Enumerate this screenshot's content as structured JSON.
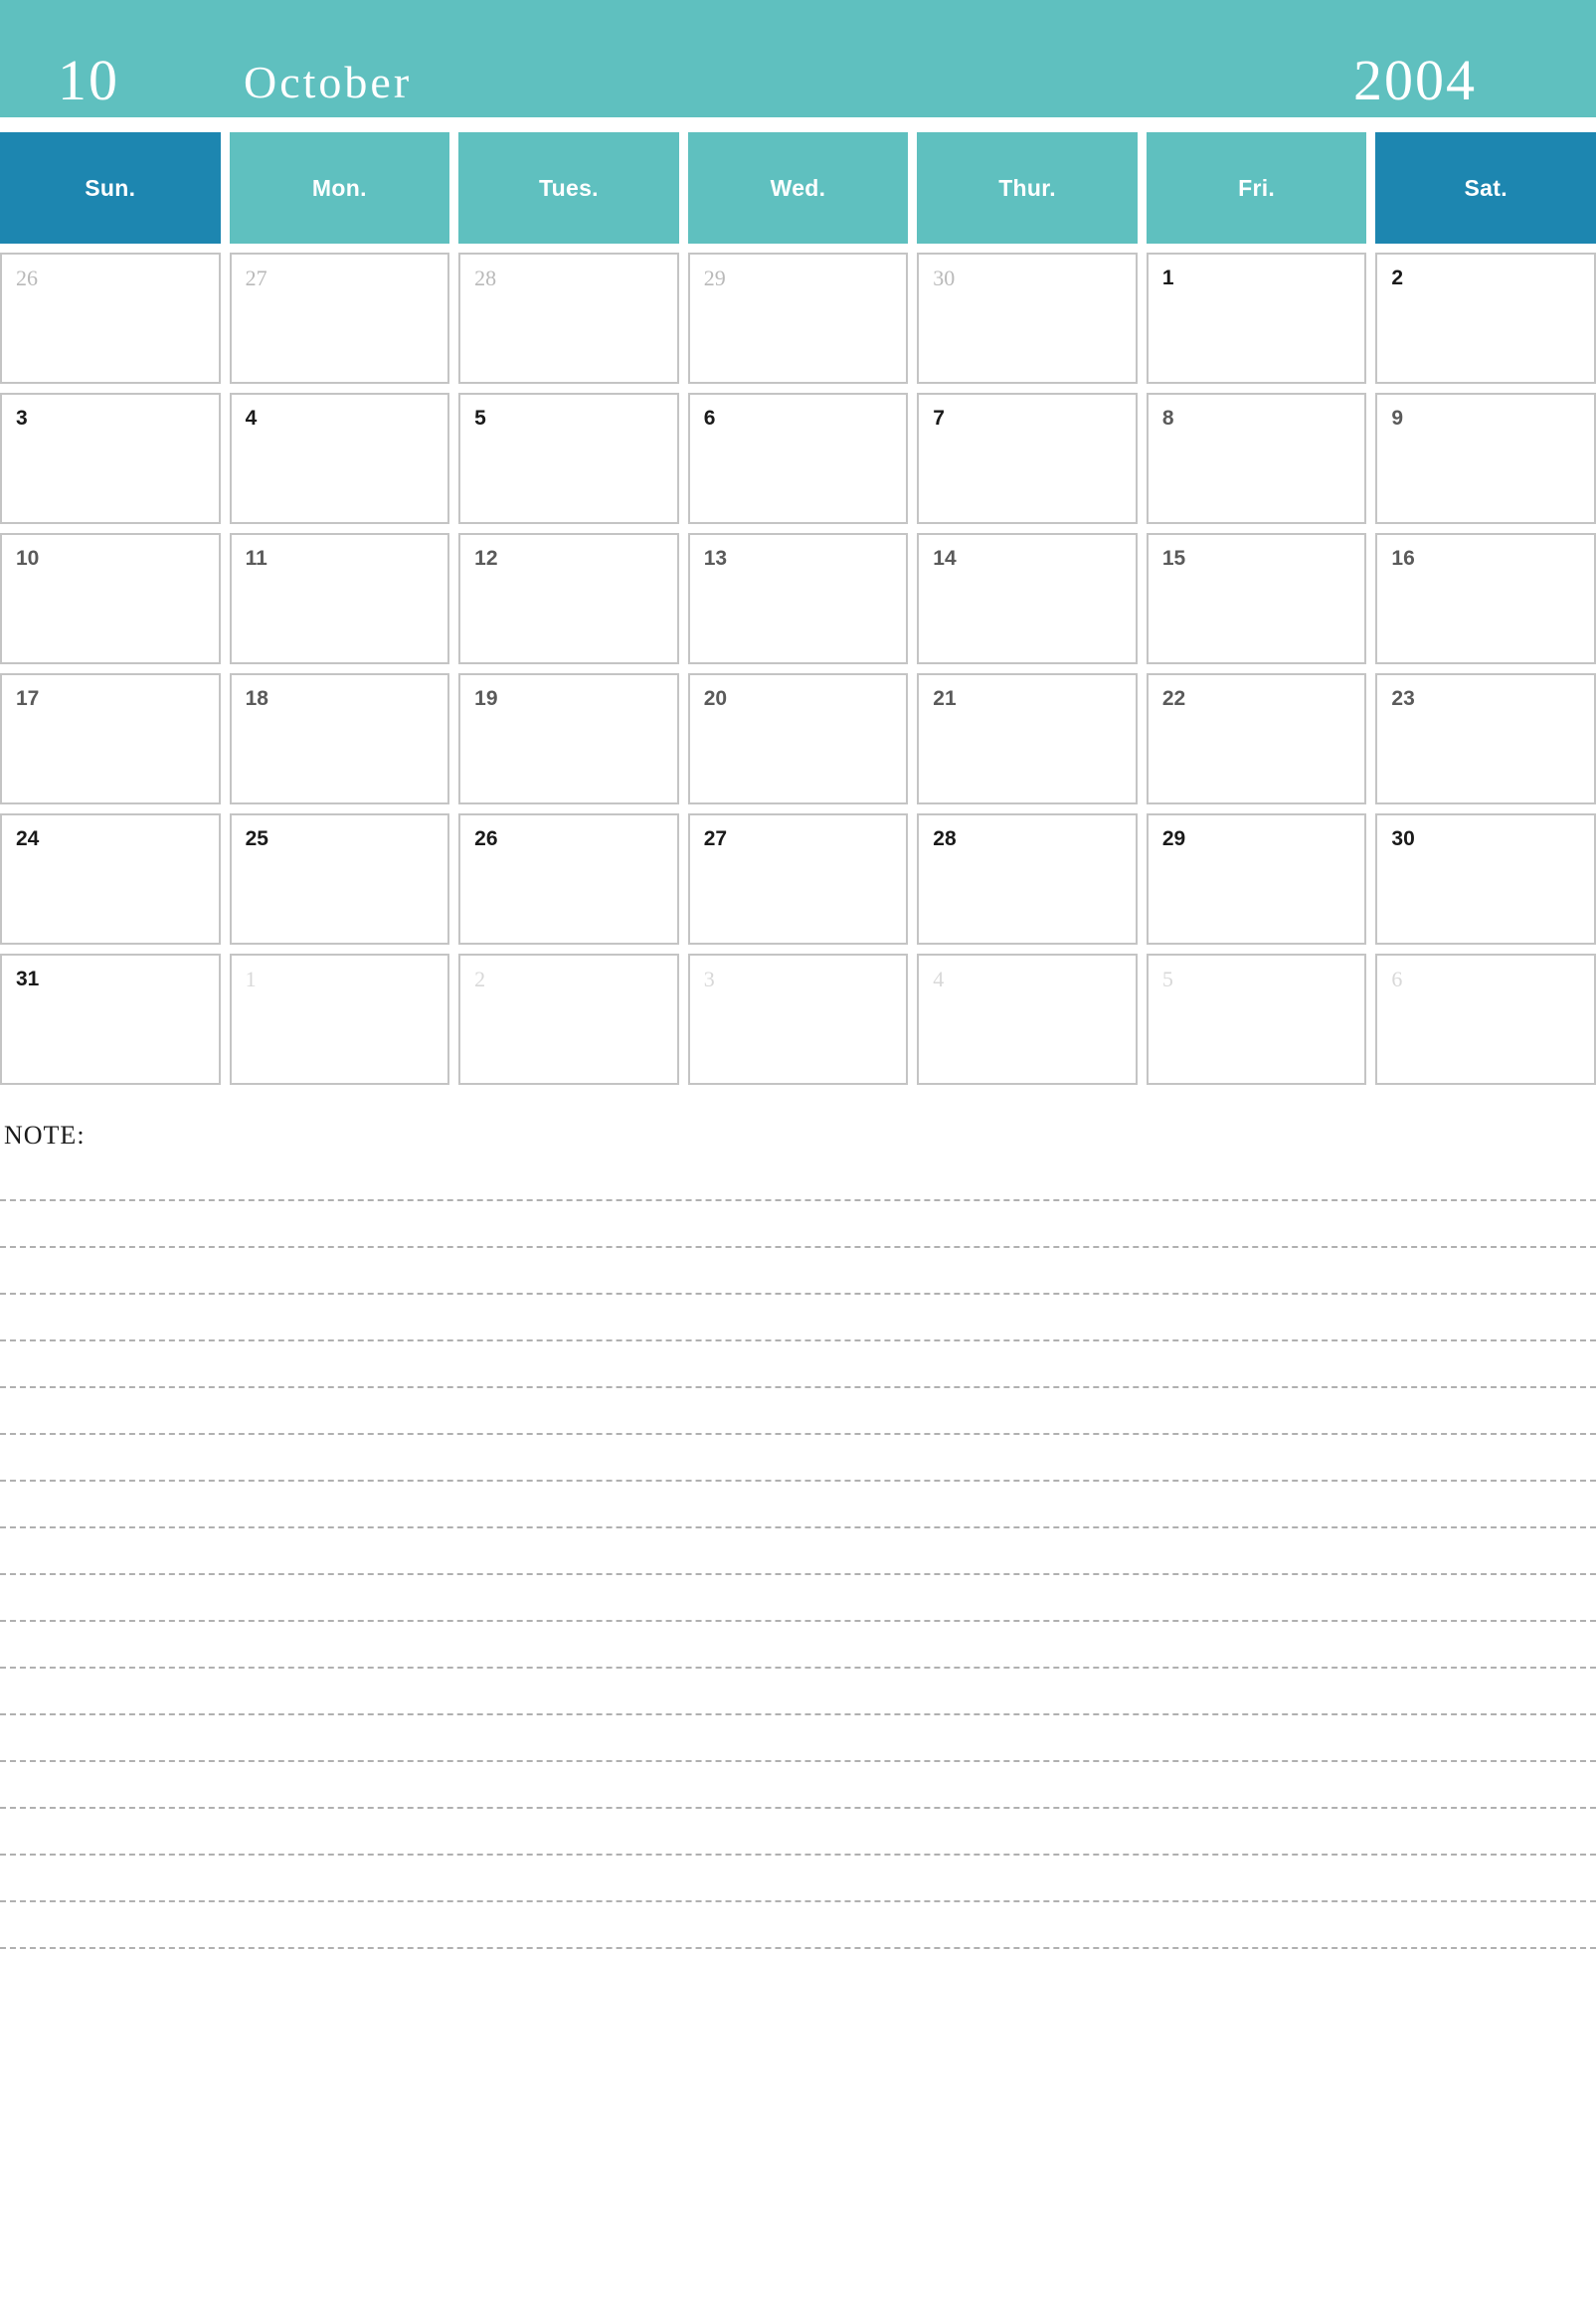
{
  "header": {
    "month_number": "10",
    "month_name": "October",
    "year": "2004",
    "background_color": "#5fc0bf",
    "text_color": "#ffffff"
  },
  "weekdays": [
    {
      "label": "Sun.",
      "weekend": true
    },
    {
      "label": "Mon.",
      "weekend": false
    },
    {
      "label": "Tues.",
      "weekend": false
    },
    {
      "label": "Wed.",
      "weekend": false
    },
    {
      "label": "Thur.",
      "weekend": false
    },
    {
      "label": "Fri.",
      "weekend": false
    },
    {
      "label": "Sat.",
      "weekend": true
    }
  ],
  "colors": {
    "teal": "#5fc0bf",
    "blue": "#1d86b0",
    "cell_border": "#c4c4c4",
    "note_line": "#b0b0b0"
  },
  "weeks": [
    [
      {
        "day": "26",
        "style": "adjacent"
      },
      {
        "day": "27",
        "style": "adjacent"
      },
      {
        "day": "28",
        "style": "adjacent"
      },
      {
        "day": "29",
        "style": "adjacent"
      },
      {
        "day": "30",
        "style": "adjacent"
      },
      {
        "day": "1",
        "style": "current-strong"
      },
      {
        "day": "2",
        "style": "current-strong"
      }
    ],
    [
      {
        "day": "3",
        "style": "current-strong"
      },
      {
        "day": "4",
        "style": "current-strong"
      },
      {
        "day": "5",
        "style": "current-strong"
      },
      {
        "day": "6",
        "style": "current-strong"
      },
      {
        "day": "7",
        "style": "current-strong"
      },
      {
        "day": "8",
        "style": "current-mid"
      },
      {
        "day": "9",
        "style": "current-mid"
      }
    ],
    [
      {
        "day": "10",
        "style": "current-mid"
      },
      {
        "day": "11",
        "style": "current-mid"
      },
      {
        "day": "12",
        "style": "current-mid"
      },
      {
        "day": "13",
        "style": "current-mid"
      },
      {
        "day": "14",
        "style": "current-mid"
      },
      {
        "day": "15",
        "style": "current-mid"
      },
      {
        "day": "16",
        "style": "current-mid"
      }
    ],
    [
      {
        "day": "17",
        "style": "current-mid"
      },
      {
        "day": "18",
        "style": "current-mid"
      },
      {
        "day": "19",
        "style": "current-mid"
      },
      {
        "day": "20",
        "style": "current-mid"
      },
      {
        "day": "21",
        "style": "current-mid"
      },
      {
        "day": "22",
        "style": "current-mid"
      },
      {
        "day": "23",
        "style": "current-mid"
      }
    ],
    [
      {
        "day": "24",
        "style": "current-strong"
      },
      {
        "day": "25",
        "style": "current-strong"
      },
      {
        "day": "26",
        "style": "current-strong"
      },
      {
        "day": "27",
        "style": "current-strong"
      },
      {
        "day": "28",
        "style": "current-strong"
      },
      {
        "day": "29",
        "style": "current-strong"
      },
      {
        "day": "30",
        "style": "current-strong"
      }
    ],
    [
      {
        "day": "31",
        "style": "current-strong"
      },
      {
        "day": "1",
        "style": "adjacent-faint"
      },
      {
        "day": "2",
        "style": "adjacent-faint"
      },
      {
        "day": "3",
        "style": "adjacent-faint"
      },
      {
        "day": "4",
        "style": "adjacent-faint"
      },
      {
        "day": "5",
        "style": "adjacent-faint"
      },
      {
        "day": "6",
        "style": "adjacent-faint"
      }
    ]
  ],
  "note": {
    "label": "NOTE:",
    "line_count": 17
  }
}
